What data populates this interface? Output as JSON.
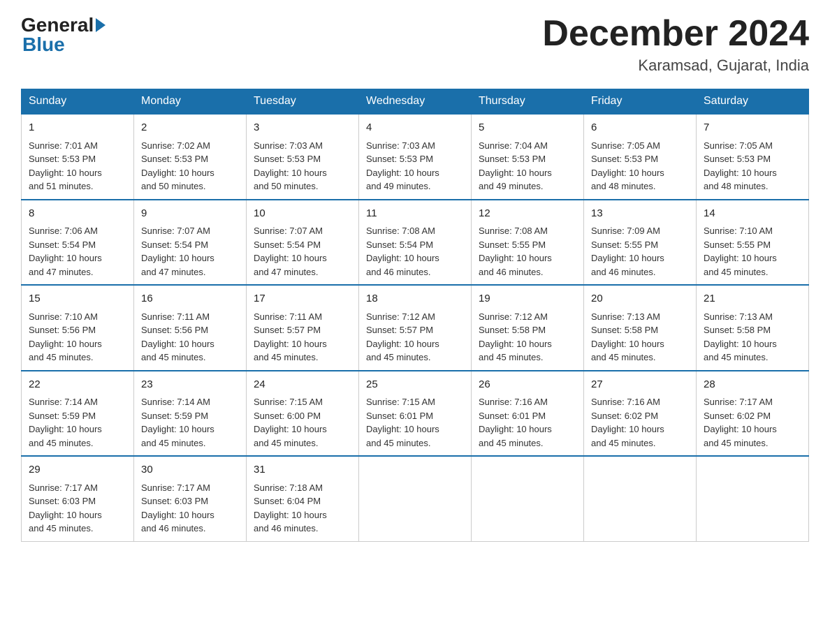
{
  "logo": {
    "general": "General",
    "blue": "Blue"
  },
  "title": {
    "month": "December 2024",
    "location": "Karamsad, Gujarat, India"
  },
  "weekdays": [
    "Sunday",
    "Monday",
    "Tuesday",
    "Wednesday",
    "Thursday",
    "Friday",
    "Saturday"
  ],
  "weeks": [
    [
      {
        "day": "1",
        "sunrise": "7:01 AM",
        "sunset": "5:53 PM",
        "daylight": "10 hours and 51 minutes."
      },
      {
        "day": "2",
        "sunrise": "7:02 AM",
        "sunset": "5:53 PM",
        "daylight": "10 hours and 50 minutes."
      },
      {
        "day": "3",
        "sunrise": "7:03 AM",
        "sunset": "5:53 PM",
        "daylight": "10 hours and 50 minutes."
      },
      {
        "day": "4",
        "sunrise": "7:03 AM",
        "sunset": "5:53 PM",
        "daylight": "10 hours and 49 minutes."
      },
      {
        "day": "5",
        "sunrise": "7:04 AM",
        "sunset": "5:53 PM",
        "daylight": "10 hours and 49 minutes."
      },
      {
        "day": "6",
        "sunrise": "7:05 AM",
        "sunset": "5:53 PM",
        "daylight": "10 hours and 48 minutes."
      },
      {
        "day": "7",
        "sunrise": "7:05 AM",
        "sunset": "5:53 PM",
        "daylight": "10 hours and 48 minutes."
      }
    ],
    [
      {
        "day": "8",
        "sunrise": "7:06 AM",
        "sunset": "5:54 PM",
        "daylight": "10 hours and 47 minutes."
      },
      {
        "day": "9",
        "sunrise": "7:07 AM",
        "sunset": "5:54 PM",
        "daylight": "10 hours and 47 minutes."
      },
      {
        "day": "10",
        "sunrise": "7:07 AM",
        "sunset": "5:54 PM",
        "daylight": "10 hours and 47 minutes."
      },
      {
        "day": "11",
        "sunrise": "7:08 AM",
        "sunset": "5:54 PM",
        "daylight": "10 hours and 46 minutes."
      },
      {
        "day": "12",
        "sunrise": "7:08 AM",
        "sunset": "5:55 PM",
        "daylight": "10 hours and 46 minutes."
      },
      {
        "day": "13",
        "sunrise": "7:09 AM",
        "sunset": "5:55 PM",
        "daylight": "10 hours and 46 minutes."
      },
      {
        "day": "14",
        "sunrise": "7:10 AM",
        "sunset": "5:55 PM",
        "daylight": "10 hours and 45 minutes."
      }
    ],
    [
      {
        "day": "15",
        "sunrise": "7:10 AM",
        "sunset": "5:56 PM",
        "daylight": "10 hours and 45 minutes."
      },
      {
        "day": "16",
        "sunrise": "7:11 AM",
        "sunset": "5:56 PM",
        "daylight": "10 hours and 45 minutes."
      },
      {
        "day": "17",
        "sunrise": "7:11 AM",
        "sunset": "5:57 PM",
        "daylight": "10 hours and 45 minutes."
      },
      {
        "day": "18",
        "sunrise": "7:12 AM",
        "sunset": "5:57 PM",
        "daylight": "10 hours and 45 minutes."
      },
      {
        "day": "19",
        "sunrise": "7:12 AM",
        "sunset": "5:58 PM",
        "daylight": "10 hours and 45 minutes."
      },
      {
        "day": "20",
        "sunrise": "7:13 AM",
        "sunset": "5:58 PM",
        "daylight": "10 hours and 45 minutes."
      },
      {
        "day": "21",
        "sunrise": "7:13 AM",
        "sunset": "5:58 PM",
        "daylight": "10 hours and 45 minutes."
      }
    ],
    [
      {
        "day": "22",
        "sunrise": "7:14 AM",
        "sunset": "5:59 PM",
        "daylight": "10 hours and 45 minutes."
      },
      {
        "day": "23",
        "sunrise": "7:14 AM",
        "sunset": "5:59 PM",
        "daylight": "10 hours and 45 minutes."
      },
      {
        "day": "24",
        "sunrise": "7:15 AM",
        "sunset": "6:00 PM",
        "daylight": "10 hours and 45 minutes."
      },
      {
        "day": "25",
        "sunrise": "7:15 AM",
        "sunset": "6:01 PM",
        "daylight": "10 hours and 45 minutes."
      },
      {
        "day": "26",
        "sunrise": "7:16 AM",
        "sunset": "6:01 PM",
        "daylight": "10 hours and 45 minutes."
      },
      {
        "day": "27",
        "sunrise": "7:16 AM",
        "sunset": "6:02 PM",
        "daylight": "10 hours and 45 minutes."
      },
      {
        "day": "28",
        "sunrise": "7:17 AM",
        "sunset": "6:02 PM",
        "daylight": "10 hours and 45 minutes."
      }
    ],
    [
      {
        "day": "29",
        "sunrise": "7:17 AM",
        "sunset": "6:03 PM",
        "daylight": "10 hours and 45 minutes."
      },
      {
        "day": "30",
        "sunrise": "7:17 AM",
        "sunset": "6:03 PM",
        "daylight": "10 hours and 46 minutes."
      },
      {
        "day": "31",
        "sunrise": "7:18 AM",
        "sunset": "6:04 PM",
        "daylight": "10 hours and 46 minutes."
      },
      null,
      null,
      null,
      null
    ]
  ],
  "labels": {
    "sunrise": "Sunrise:",
    "sunset": "Sunset:",
    "daylight": "Daylight:"
  }
}
